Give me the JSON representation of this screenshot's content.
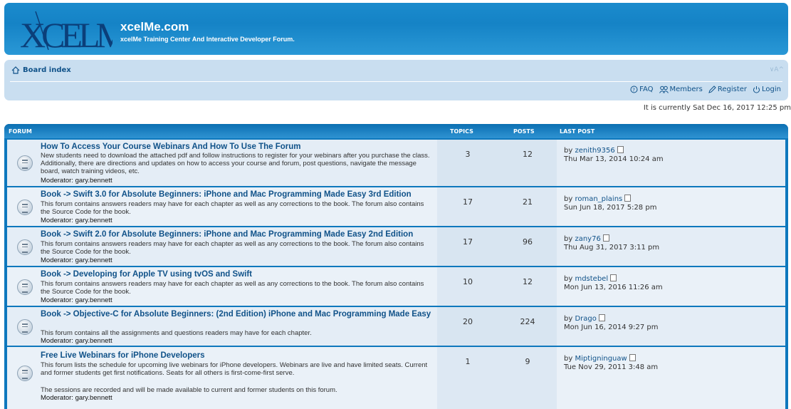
{
  "header": {
    "logo_text": "XCELME",
    "site_title": "xcelMe.com",
    "site_desc": "xcelMe Training Center And Interactive Developer Forum."
  },
  "nav": {
    "board_index": "Board index",
    "font_size": "∨A^",
    "links": [
      "FAQ",
      "Members",
      "Register",
      "Login"
    ],
    "current_time": "It is currently Sat Dec 16, 2017 12:25 pm"
  },
  "table": {
    "headers": {
      "forum": "FORUM",
      "topics": "TOPICS",
      "posts": "POSTS",
      "last_post": "LAST POST"
    },
    "rows": [
      {
        "title": "How To Access Your Course Webinars And How To Use The Forum",
        "desc": "New students need to download the attached pdf and follow instructions to register for your webinars after you purchase the class. Additionally, there are directions and updates on how to access your course and forum, post questions, navigate the message board, watch training videos, etc.",
        "moderator_label": "Moderator:",
        "moderator": "gary.bennett",
        "topics": "3",
        "posts": "12",
        "by": "by",
        "poster": "zenith9356",
        "date": "Thu Mar 13, 2014 10:24 am"
      },
      {
        "title": "Book -> Swift 3.0 for Absolute Beginners: iPhone and Mac Programming Made Easy 3rd Edition",
        "desc": "This forum contains answers readers may have for each chapter as well as any corrections to the book. The forum also contains the Source Code for the book.",
        "moderator_label": "Moderator:",
        "moderator": "gary.bennett",
        "topics": "17",
        "posts": "21",
        "by": "by",
        "poster": "roman_plains",
        "date": "Sun Jun 18, 2017 5:28 pm"
      },
      {
        "title": "Book -> Swift 2.0 for Absolute Beginners: iPhone and Mac Programming Made Easy 2nd Edition",
        "desc": "This forum contains answers readers may have for each chapter as well as any corrections to the book. The forum also contains the Source Code for the book.",
        "moderator_label": "Moderator:",
        "moderator": "gary.bennett",
        "topics": "17",
        "posts": "96",
        "by": "by",
        "poster": "zany76",
        "date": "Thu Aug 31, 2017 3:11 pm"
      },
      {
        "title": "Book -> Developing for Apple TV using tvOS and Swift",
        "desc": "This forum contains answers readers may have for each chapter as well as any corrections to the book. The forum also contains the Source Code for the book.",
        "moderator_label": "Moderator:",
        "moderator": "gary.bennett",
        "topics": "10",
        "posts": "12",
        "by": "by",
        "poster": "mdstebel",
        "date": "Mon Jun 13, 2016 11:26 am"
      },
      {
        "title": "Book -> Objective-C for Absolute Beginners: (2nd Edition) iPhone and Mac Programming Made Easy",
        "desc": "This forum contains all the assignments and questions readers may have for each chapter.",
        "moderator_label": "Moderator:",
        "moderator": "gary.bennett",
        "topics": "20",
        "posts": "224",
        "by": "by",
        "poster": "Drago",
        "date": "Mon Jun 16, 2014 9:27 pm"
      },
      {
        "title": "Free Live Webinars for iPhone Developers",
        "desc": "This forum lists the schedule for upcoming live webinars for iPhone developers. Webinars are live and have limited seats. Current and former students get first notifications. Seats for all others is first-come-first serve.",
        "desc2": "The sessions are recorded and will be made available to current and former students on this forum.",
        "moderator_label": "Moderator:",
        "moderator": "gary.bennett",
        "topics": "1",
        "posts": "9",
        "by": "by",
        "poster": "Miptigninguaw",
        "date": "Tue Nov 29, 2011 3:48 am"
      }
    ]
  },
  "colors": {
    "header_blue": "#1583c6",
    "nav_bg": "#c9def0",
    "link": "#105289"
  }
}
